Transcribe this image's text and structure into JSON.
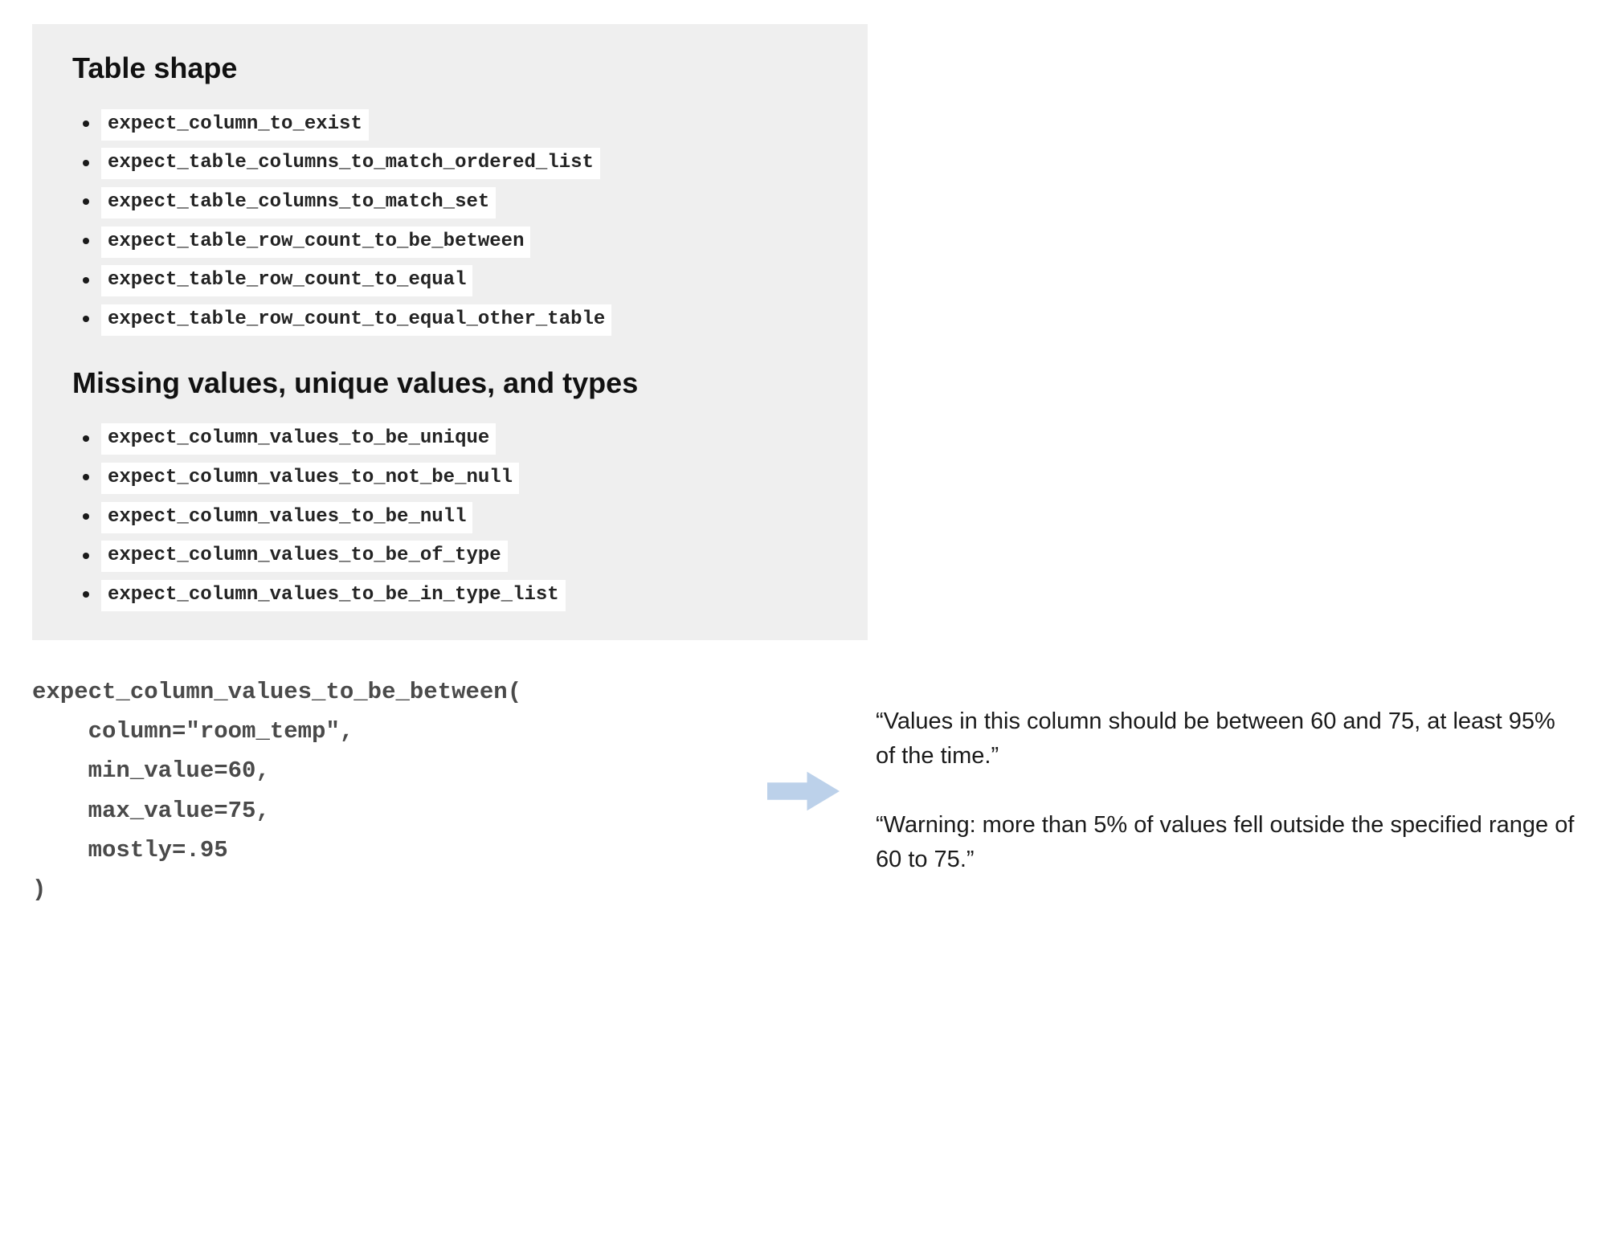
{
  "panel": {
    "sections": [
      {
        "heading": "Table shape",
        "items": [
          "expect_column_to_exist",
          "expect_table_columns_to_match_ordered_list",
          "expect_table_columns_to_match_set",
          "expect_table_row_count_to_be_between",
          "expect_table_row_count_to_equal",
          "expect_table_row_count_to_equal_other_table"
        ]
      },
      {
        "heading": "Missing values, unique values, and types",
        "items": [
          "expect_column_values_to_be_unique",
          "expect_column_values_to_not_be_null",
          "expect_column_values_to_be_null",
          "expect_column_values_to_be_of_type",
          "expect_column_values_to_be_in_type_list"
        ]
      }
    ]
  },
  "example": {
    "code": "expect_column_values_to_be_between(\n    column=\"room_temp\",\n    min_value=60,\n    max_value=75,\n    mostly=.95\n)",
    "annotations": [
      "“Values in this column should be between 60 and 75, at least 95% of the time.”",
      "“Warning: more than 5% of values fell outside the specified range of 60 to 75.”"
    ]
  }
}
